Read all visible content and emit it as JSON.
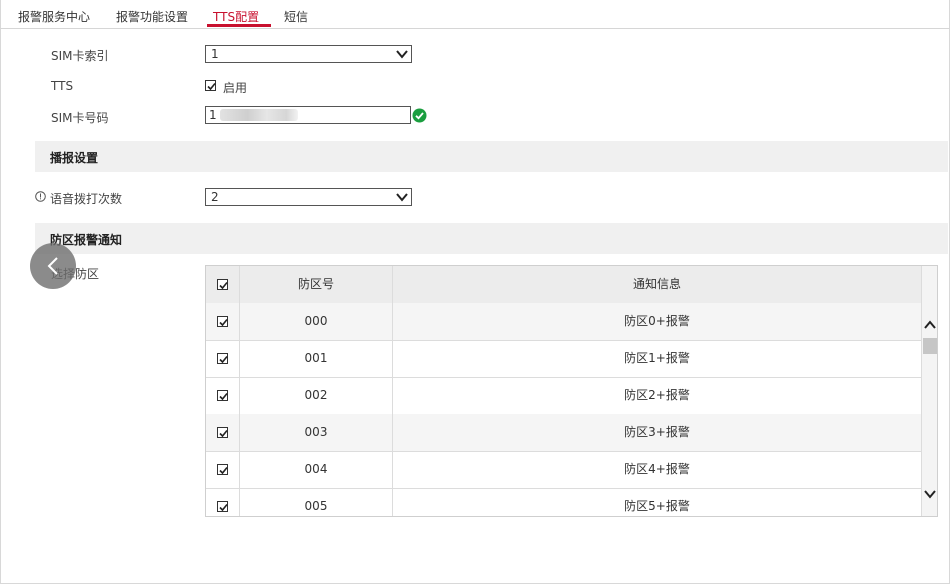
{
  "tabs": [
    {
      "label": "报警服务中心",
      "active": false
    },
    {
      "label": "报警功能设置",
      "active": false
    },
    {
      "label": "TTS配置",
      "active": true
    },
    {
      "label": "短信",
      "active": false
    }
  ],
  "form": {
    "sim_index": {
      "label": "SIM卡索引",
      "value": "1"
    },
    "tts": {
      "label": "TTS",
      "checkbox_label": "启用",
      "checked": true
    },
    "sim_number": {
      "label": "SIM卡号码",
      "value": "1",
      "valid": true
    },
    "broadcast_section": "播报设置",
    "dial_count": {
      "label": "语音拨打次数",
      "value": "2"
    },
    "zone_section": "防区报警通知",
    "select_zone_label": "选择防区"
  },
  "table": {
    "headers": [
      "防区号",
      "通知信息"
    ],
    "rows": [
      {
        "zone": "000",
        "info": "防区0+报警",
        "checked": true
      },
      {
        "zone": "001",
        "info": "防区1+报警",
        "checked": true
      },
      {
        "zone": "002",
        "info": "防区2+报警",
        "checked": true
      },
      {
        "zone": "003",
        "info": "防区3+报警",
        "checked": true
      },
      {
        "zone": "004",
        "info": "防区4+报警",
        "checked": true
      },
      {
        "zone": "005",
        "info": "防区5+报警",
        "checked": true
      }
    ]
  },
  "colors": {
    "accent": "#c8102e",
    "valid": "#1a9e3f",
    "section_bg": "#f0f0f0"
  },
  "icons": {
    "valid": "check-circle-icon",
    "info": "info-icon",
    "back": "chevron-left-icon",
    "dropdown": "chevron-down-icon"
  }
}
